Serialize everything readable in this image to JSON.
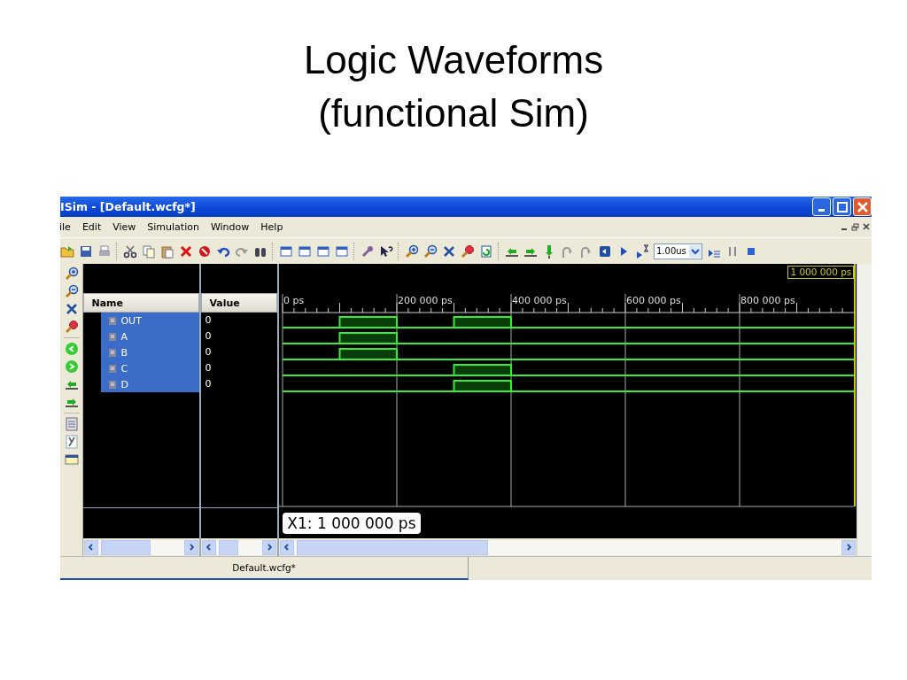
{
  "slide": {
    "title_lines": [
      "Logic Waveforms",
      "(functional Sim)"
    ]
  },
  "window": {
    "title": "ISim - [Default.wcfg*]"
  },
  "menu": [
    "ile",
    "Edit",
    "View",
    "Simulation",
    "Window",
    "Help"
  ],
  "toolbar": {
    "run_time": "1.00us"
  },
  "columns": {
    "name": "Name",
    "value": "Value"
  },
  "signals": [
    {
      "name": "OUT",
      "value": "0",
      "selected": true
    },
    {
      "name": "A",
      "value": "0",
      "selected": true
    },
    {
      "name": "B",
      "value": "0",
      "selected": true
    },
    {
      "name": "C",
      "value": "0",
      "selected": true
    },
    {
      "name": "D",
      "value": "0",
      "selected": true
    }
  ],
  "waveform": {
    "cursor_time": "1 000 000 ps",
    "cursor_label": "X1: 1 000 000 ps",
    "ruler_labels": [
      "0 ps",
      "200 000 ps",
      "400 000 ps",
      "600 000 ps",
      "800 000 ps"
    ]
  },
  "tabs": [
    {
      "label": "Default.wcfg*",
      "selected": true
    }
  ]
}
